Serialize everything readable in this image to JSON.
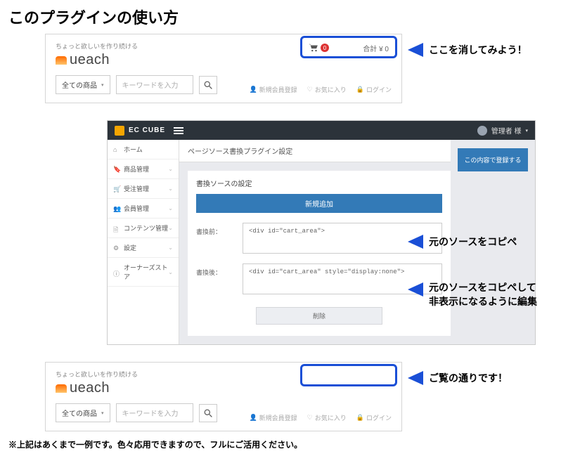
{
  "title": "このプラグインの使い方",
  "shop": {
    "tagline": "ちょっと欲しいを作り続ける",
    "brand": "ueach",
    "all_items": "全ての商品",
    "keyword_placeholder": "キーワードを入力",
    "cart_count": "0",
    "cart_total": "合計 ¥ 0",
    "links": {
      "signup": "新規会員登録",
      "fav": "お気に入り",
      "login": "ログイン"
    }
  },
  "annot": {
    "a1": "ここを消してみよう！",
    "a2": "元のソースをコピペ",
    "a3_l1": "元のソースをコピペして",
    "a3_l2": "非表示になるように編集",
    "a4": "ご覧の通りです！"
  },
  "admin": {
    "product": "EC CUBE",
    "user": "管理者 様",
    "side": [
      {
        "icon": "⌂",
        "label": "ホーム",
        "caret": false
      },
      {
        "icon": "🔖",
        "label": "商品管理",
        "caret": true
      },
      {
        "icon": "🛒",
        "label": "受注管理",
        "caret": true
      },
      {
        "icon": "👥",
        "label": "会員管理",
        "caret": true
      },
      {
        "icon": "🗎",
        "label": "コンテンツ管理",
        "caret": true
      },
      {
        "icon": "⚙",
        "label": "設定",
        "caret": true
      },
      {
        "icon": "ⓘ",
        "label": "オーナーズストア",
        "caret": true
      }
    ],
    "crumb": "ページソース書換プラグイン設定",
    "panel_title": "書換ソースの設定",
    "add": "新規追加",
    "before_label": "書換前：",
    "before_code": "<div id=\"cart_area\">",
    "after_label": "書換後：",
    "after_code": "<div id=\"cart_area\" style=\"display:none\">",
    "delete": "削除",
    "save": "この内容で登録する"
  },
  "footnote": "※上記はあくまで一例です。色々応用できますので、フルにご活用ください。"
}
